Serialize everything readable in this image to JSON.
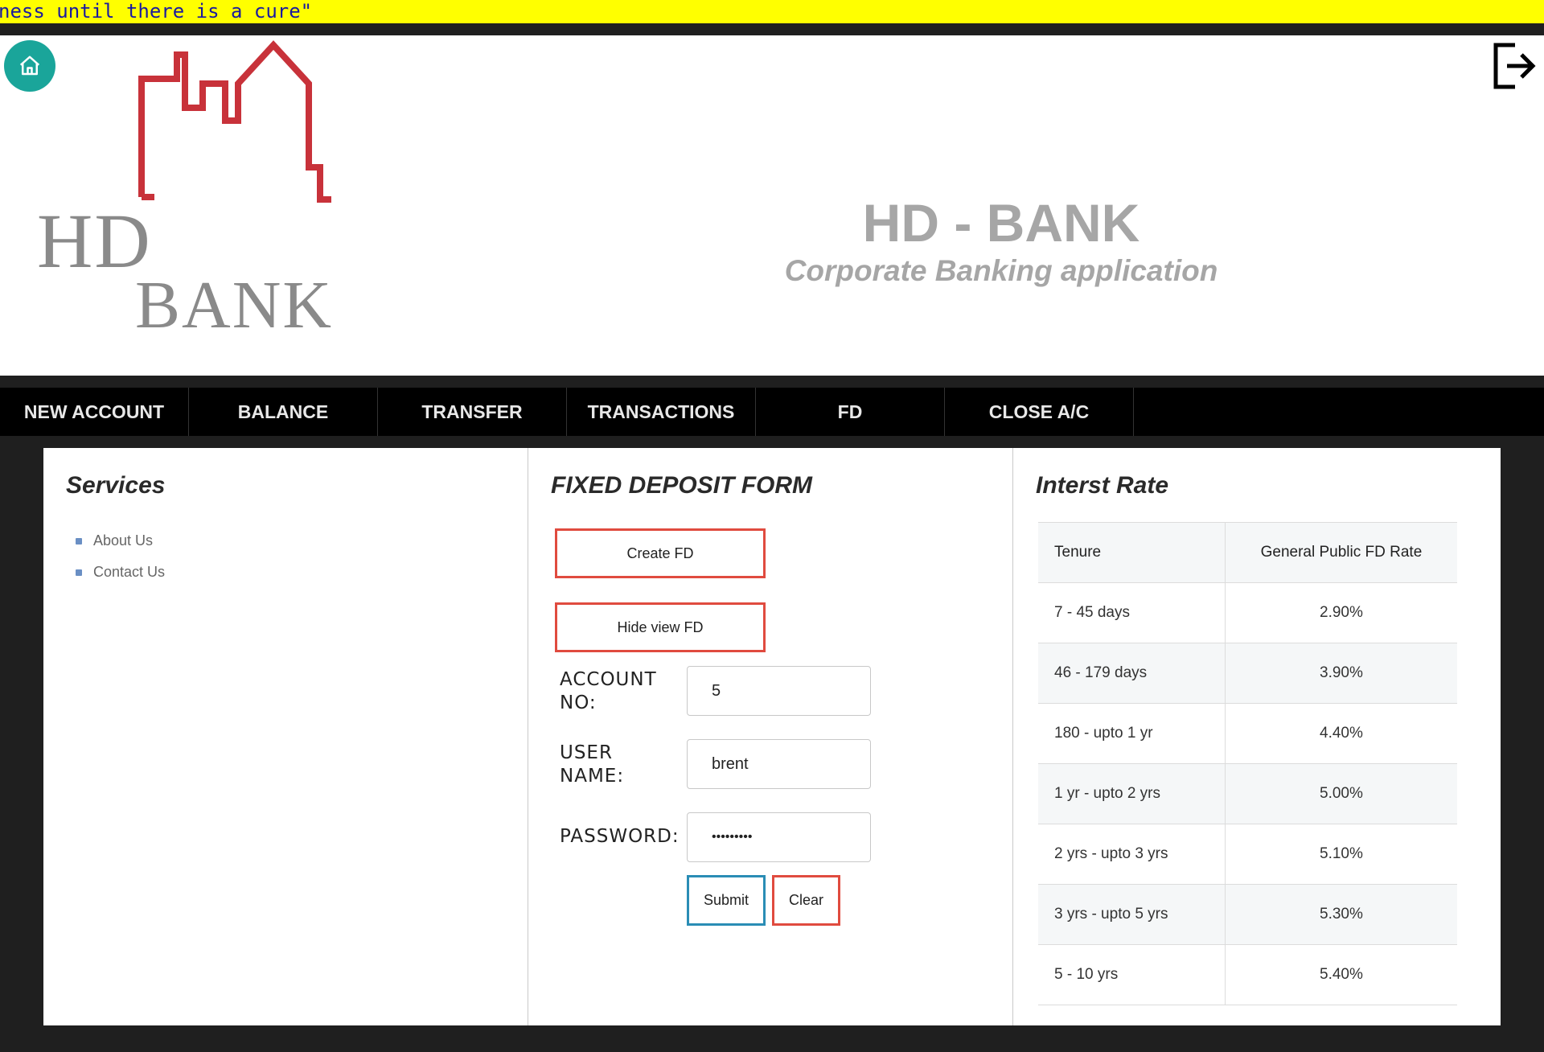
{
  "marquee": {
    "text": "ness until there is a cure\""
  },
  "header": {
    "logo_line1": "HD",
    "logo_line2": "BANK",
    "title": "HD - BANK",
    "subtitle": "Corporate Banking application"
  },
  "menu": {
    "items": [
      {
        "label": "NEW ACCOUNT"
      },
      {
        "label": "BALANCE"
      },
      {
        "label": "TRANSFER"
      },
      {
        "label": "TRANSACTIONS"
      },
      {
        "label": "FD"
      },
      {
        "label": "CLOSE A/C"
      }
    ]
  },
  "services": {
    "title": "Services",
    "items": [
      {
        "label": "About Us"
      },
      {
        "label": "Contact Us"
      }
    ]
  },
  "fd_form": {
    "title": "FIXED DEPOSIT FORM",
    "create_label": "Create FD",
    "hide_view_label": "Hide view FD",
    "account_label_line1": "ACCOUNT",
    "account_label_line2": "NO:",
    "account_value": "5",
    "user_label_line1": "USER",
    "user_label_line2": "NAME:",
    "user_value": "brent",
    "password_label": "PASSWORD:",
    "password_value": "•••••••••",
    "submit_label": "Submit",
    "clear_label": "Clear"
  },
  "rates": {
    "title": "Interst Rate",
    "headers": [
      "Tenure",
      "General Public FD Rate"
    ],
    "rows": [
      {
        "tenure": "7 - 45 days",
        "rate": "2.90%"
      },
      {
        "tenure": "46 - 179 days",
        "rate": "3.90%"
      },
      {
        "tenure": "180 - upto 1 yr",
        "rate": "4.40%"
      },
      {
        "tenure": "1 yr - upto 2 yrs",
        "rate": "5.00%"
      },
      {
        "tenure": "2 yrs - upto 3 yrs",
        "rate": "5.10%"
      },
      {
        "tenure": "3 yrs - upto 5 yrs",
        "rate": "5.30%"
      },
      {
        "tenure": "5 - 10 yrs",
        "rate": "5.40%"
      }
    ]
  },
  "colors": {
    "marquee_bg": "#ffff00",
    "home_btn": "#1aa59a",
    "logo_red": "#c8323a",
    "accent_red": "#e04b3f",
    "accent_blue": "#2a8db5"
  }
}
